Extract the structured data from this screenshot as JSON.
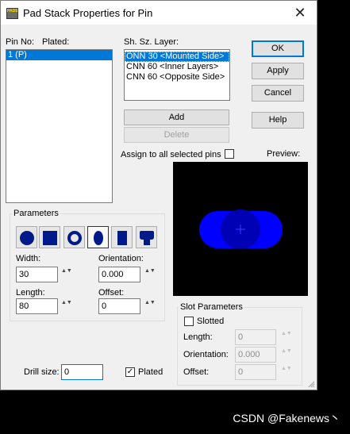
{
  "window": {
    "title": "Pad Stack Properties for Pin",
    "icon_text": "PADS",
    "close_glyph": "✕"
  },
  "pins": {
    "pin_no_label": "Pin No:",
    "plated_label": "Plated:",
    "items": [
      "1 (P)"
    ]
  },
  "layers": {
    "header": "Sh. Sz. Layer:",
    "items": [
      "ONN 30 <Mounted Side>",
      "CNN 60 <Inner Layers>",
      "CNN 60 <Opposite Side>"
    ]
  },
  "buttons": {
    "ok": "OK",
    "apply": "Apply",
    "cancel": "Cancel",
    "help": "Help",
    "add": "Add",
    "delete": "Delete"
  },
  "assign": {
    "label": "Assign to all selected pins",
    "checked": false
  },
  "preview": {
    "label": "Preview:",
    "pad_color": "#0000ff",
    "center_color": "#0000b4"
  },
  "parameters": {
    "title": "Parameters",
    "shapes": [
      "round-pad",
      "square-pad",
      "annular-pad",
      "oval-pad",
      "rectangle-pad",
      "odd-shape-pad"
    ],
    "selected_shape": "oval-pad",
    "width_label": "Width:",
    "width_value": "30",
    "orientation_label": "Orientation:",
    "orientation_value": "0.000",
    "length_label": "Length:",
    "length_value": "80",
    "offset_label": "Offset:",
    "offset_value": "0",
    "spin_glyph": "▲▼"
  },
  "slot": {
    "title": "Slot Parameters",
    "slotted_label": "Slotted",
    "slotted_checked": false,
    "length_label": "Length:",
    "length_value": "0",
    "orientation_label": "Orientation:",
    "orientation_value": "0.000",
    "offset_label": "Offset:",
    "offset_value": "0"
  },
  "drill": {
    "label": "Drill size:",
    "value": "0",
    "plated_label": "Plated",
    "plated_checked": true,
    "check_glyph": "✓"
  },
  "watermark": "CSDN @Fakenews丶",
  "colors": {
    "selection": "#0078d7",
    "dialog_bg": "#f0f0f0",
    "shape_icon": "#001a8a"
  }
}
